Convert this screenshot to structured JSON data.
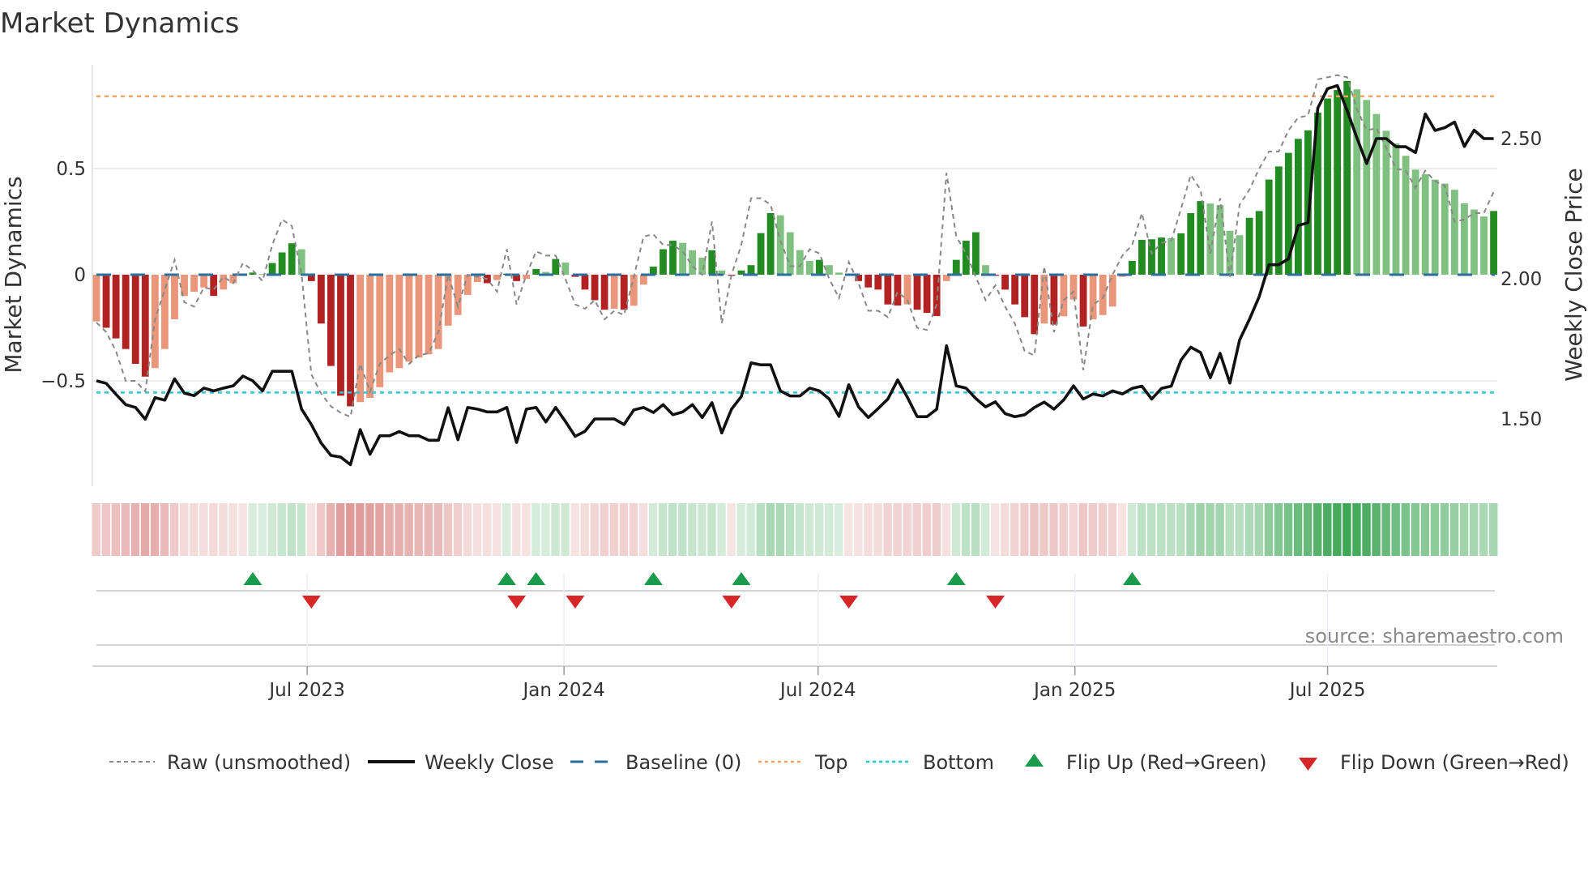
{
  "title": "Market Dynamics",
  "source": "source: sharemaestro.com",
  "colors": {
    "fall_neg": "#b22222",
    "rise_neg": "#e9967a",
    "rise_pos": "#228b22",
    "fall_pos": "#80c080",
    "baseline": "#2b6f9e",
    "top": "#f4a460",
    "bottom": "#2ec4d6",
    "raw": "#888888",
    "close": "#111111",
    "flip_up": "#1a9a4a",
    "flip_down": "#d62728"
  },
  "legend": {
    "raw": "Raw (unsmoothed)",
    "close": "Weekly Close",
    "baseline": "Baseline (0)",
    "top": "Top",
    "bottom": "Bottom",
    "flip_up": "Flip Up (Red→Green)",
    "flip_down": "Flip Down (Green→Red)"
  },
  "chart_data": {
    "type": "bar",
    "title": "Market Dynamics",
    "ylabel": "Market Dynamics",
    "ylabel_right": "Weekly Close Price",
    "frequency": "weekly",
    "start_date": "2023-01-31",
    "ylim": [
      -1.0,
      0.99
    ],
    "ylim_right": [
      1.26,
      2.76
    ],
    "yticks_left": [
      {
        "value": 0.5,
        "label": "0.5"
      },
      {
        "value": 0,
        "label": "0"
      },
      {
        "value": -0.5,
        "label": "−0.5"
      }
    ],
    "yticks_right": [
      {
        "value": 2.5,
        "label": "2.50"
      },
      {
        "value": 2.0,
        "label": "2.00"
      },
      {
        "value": 1.5,
        "label": "1.50"
      }
    ],
    "xticks": [
      {
        "date": "2023-07-01",
        "label": "Jul 2023"
      },
      {
        "date": "2024-01-01",
        "label": "Jan 2024"
      },
      {
        "date": "2024-07-01",
        "label": "Jul 2024"
      },
      {
        "date": "2025-01-01",
        "label": "Jan 2025"
      },
      {
        "date": "2025-07-01",
        "label": "Jul 2025"
      }
    ],
    "top_level": 0.84,
    "bottom_level": -0.555,
    "baseline": 0,
    "grid": true,
    "legend_position": "bottom",
    "dynamics": [
      -0.22,
      -0.25,
      -0.3,
      -0.35,
      -0.42,
      -0.48,
      -0.44,
      -0.35,
      -0.21,
      -0.1,
      -0.08,
      -0.06,
      -0.1,
      -0.07,
      -0.04,
      -0.005,
      0.01,
      0.003,
      0.055,
      0.105,
      0.148,
      0.12,
      -0.03,
      -0.23,
      -0.43,
      -0.57,
      -0.62,
      -0.6,
      -0.58,
      -0.53,
      -0.46,
      -0.44,
      -0.41,
      -0.39,
      -0.375,
      -0.35,
      -0.24,
      -0.19,
      -0.095,
      -0.035,
      -0.04,
      -0.025,
      0.005,
      -0.03,
      -0.02,
      0.027,
      0.013,
      0.074,
      0.057,
      -0.01,
      -0.07,
      -0.12,
      -0.165,
      -0.16,
      -0.165,
      -0.146,
      -0.047,
      0.038,
      0.12,
      0.16,
      0.15,
      0.115,
      0.08,
      0.115,
      0.02,
      -0.005,
      0.02,
      0.045,
      0.196,
      0.29,
      0.28,
      0.2,
      0.116,
      0.065,
      0.07,
      0.045,
      0.01,
      -0.005,
      -0.03,
      -0.06,
      -0.07,
      -0.14,
      -0.145,
      -0.14,
      -0.165,
      -0.18,
      -0.195,
      -0.03,
      0.07,
      0.16,
      0.2,
      0.045,
      -0.005,
      -0.07,
      -0.14,
      -0.2,
      -0.28,
      -0.23,
      -0.235,
      -0.196,
      -0.117,
      -0.244,
      -0.21,
      -0.19,
      -0.15,
      -0.01,
      0.065,
      0.164,
      0.167,
      0.175,
      0.172,
      0.195,
      0.29,
      0.347,
      0.335,
      0.328,
      0.207,
      0.186,
      0.268,
      0.3,
      0.448,
      0.51,
      0.574,
      0.64,
      0.68,
      0.763,
      0.83,
      0.87,
      0.913,
      0.873,
      0.823,
      0.757,
      0.678,
      0.618,
      0.56,
      0.495,
      0.473,
      0.448,
      0.429,
      0.4,
      0.336,
      0.307,
      0.274,
      0.3
    ],
    "raw": [
      -0.225,
      -0.27,
      -0.36,
      -0.5,
      -0.5,
      -0.55,
      -0.21,
      -0.07,
      0.07,
      -0.13,
      -0.15,
      -0.06,
      -0.07,
      -0.01,
      -0.04,
      0.055,
      0.02,
      -0.03,
      0.14,
      0.26,
      0.23,
      0.0,
      -0.47,
      -0.56,
      -0.62,
      -0.65,
      -0.67,
      -0.42,
      -0.55,
      -0.42,
      -0.38,
      -0.35,
      -0.42,
      -0.38,
      -0.37,
      -0.27,
      0.0,
      -0.15,
      0.0,
      -0.01,
      -0.02,
      -0.08,
      0.12,
      -0.14,
      0.0,
      0.11,
      0.09,
      0.09,
      -0.02,
      -0.14,
      -0.16,
      -0.12,
      -0.21,
      -0.17,
      -0.19,
      -0.01,
      0.18,
      0.19,
      0.14,
      0.14,
      0.11,
      0.04,
      0.0,
      0.25,
      -0.23,
      0.0,
      0.14,
      0.36,
      0.36,
      0.33,
      0.16,
      0.04,
      0.04,
      0.12,
      0.1,
      -0.02,
      -0.11,
      0.06,
      -0.04,
      -0.17,
      -0.17,
      -0.2,
      -0.08,
      -0.12,
      -0.25,
      -0.26,
      -0.14,
      0.48,
      0.18,
      0.1,
      -0.01,
      -0.12,
      -0.05,
      -0.15,
      -0.23,
      -0.36,
      -0.38,
      0.04,
      -0.27,
      -0.12,
      -0.08,
      -0.45,
      -0.14,
      -0.11,
      0.0,
      0.09,
      0.14,
      0.29,
      0.1,
      0.15,
      0.16,
      0.31,
      0.47,
      0.4,
      0.1,
      0.36,
      -0.01,
      0.33,
      0.4,
      0.5,
      0.58,
      0.58,
      0.68,
      0.74,
      0.75,
      0.92,
      0.93,
      0.94,
      0.93,
      0.78,
      0.68,
      0.69,
      0.6,
      0.5,
      0.49,
      0.41,
      0.49,
      0.44,
      0.42,
      0.25,
      0.26,
      0.29,
      0.29,
      0.39
    ],
    "weekly_close": [
      1.636,
      1.627,
      1.588,
      1.551,
      1.541,
      1.499,
      1.576,
      1.567,
      1.643,
      1.592,
      1.583,
      1.61,
      1.6,
      1.61,
      1.618,
      1.653,
      1.636,
      1.6,
      1.67,
      1.67,
      1.67,
      1.535,
      1.48,
      1.414,
      1.37,
      1.364,
      1.337,
      1.462,
      1.374,
      1.44,
      1.44,
      1.455,
      1.44,
      1.44,
      1.424,
      1.424,
      1.54,
      1.426,
      1.541,
      1.535,
      1.525,
      1.525,
      1.541,
      1.416,
      1.535,
      1.541,
      1.489,
      1.541,
      1.491,
      1.438,
      1.456,
      1.5,
      1.5,
      1.5,
      1.48,
      1.532,
      1.541,
      1.523,
      1.551,
      1.515,
      1.525,
      1.551,
      1.505,
      1.558,
      1.45,
      1.535,
      1.58,
      1.7,
      1.693,
      1.693,
      1.6,
      1.582,
      1.582,
      1.61,
      1.6,
      1.571,
      1.509,
      1.622,
      1.543,
      1.505,
      1.537,
      1.571,
      1.639,
      1.577,
      1.508,
      1.508,
      1.535,
      1.761,
      1.618,
      1.61,
      1.573,
      1.543,
      1.561,
      1.519,
      1.508,
      1.515,
      1.541,
      1.56,
      1.535,
      1.568,
      1.618,
      1.571,
      1.589,
      1.582,
      1.6,
      1.589,
      1.609,
      1.617,
      1.571,
      1.609,
      1.617,
      1.71,
      1.756,
      1.737,
      1.647,
      1.734,
      1.628,
      1.782,
      1.855,
      1.936,
      2.05,
      2.05,
      2.071,
      2.19,
      2.2,
      2.609,
      2.678,
      2.689,
      2.6,
      2.503,
      2.411,
      2.5,
      2.5,
      2.471,
      2.471,
      2.45,
      2.588,
      2.529,
      2.539,
      2.559,
      2.472,
      2.53,
      2.5,
      2.5
    ],
    "flip_up_weeks": [
      16,
      42,
      45,
      57,
      66,
      88,
      106
    ],
    "flip_down_weeks": [
      22,
      43,
      49,
      65,
      77,
      92
    ]
  }
}
